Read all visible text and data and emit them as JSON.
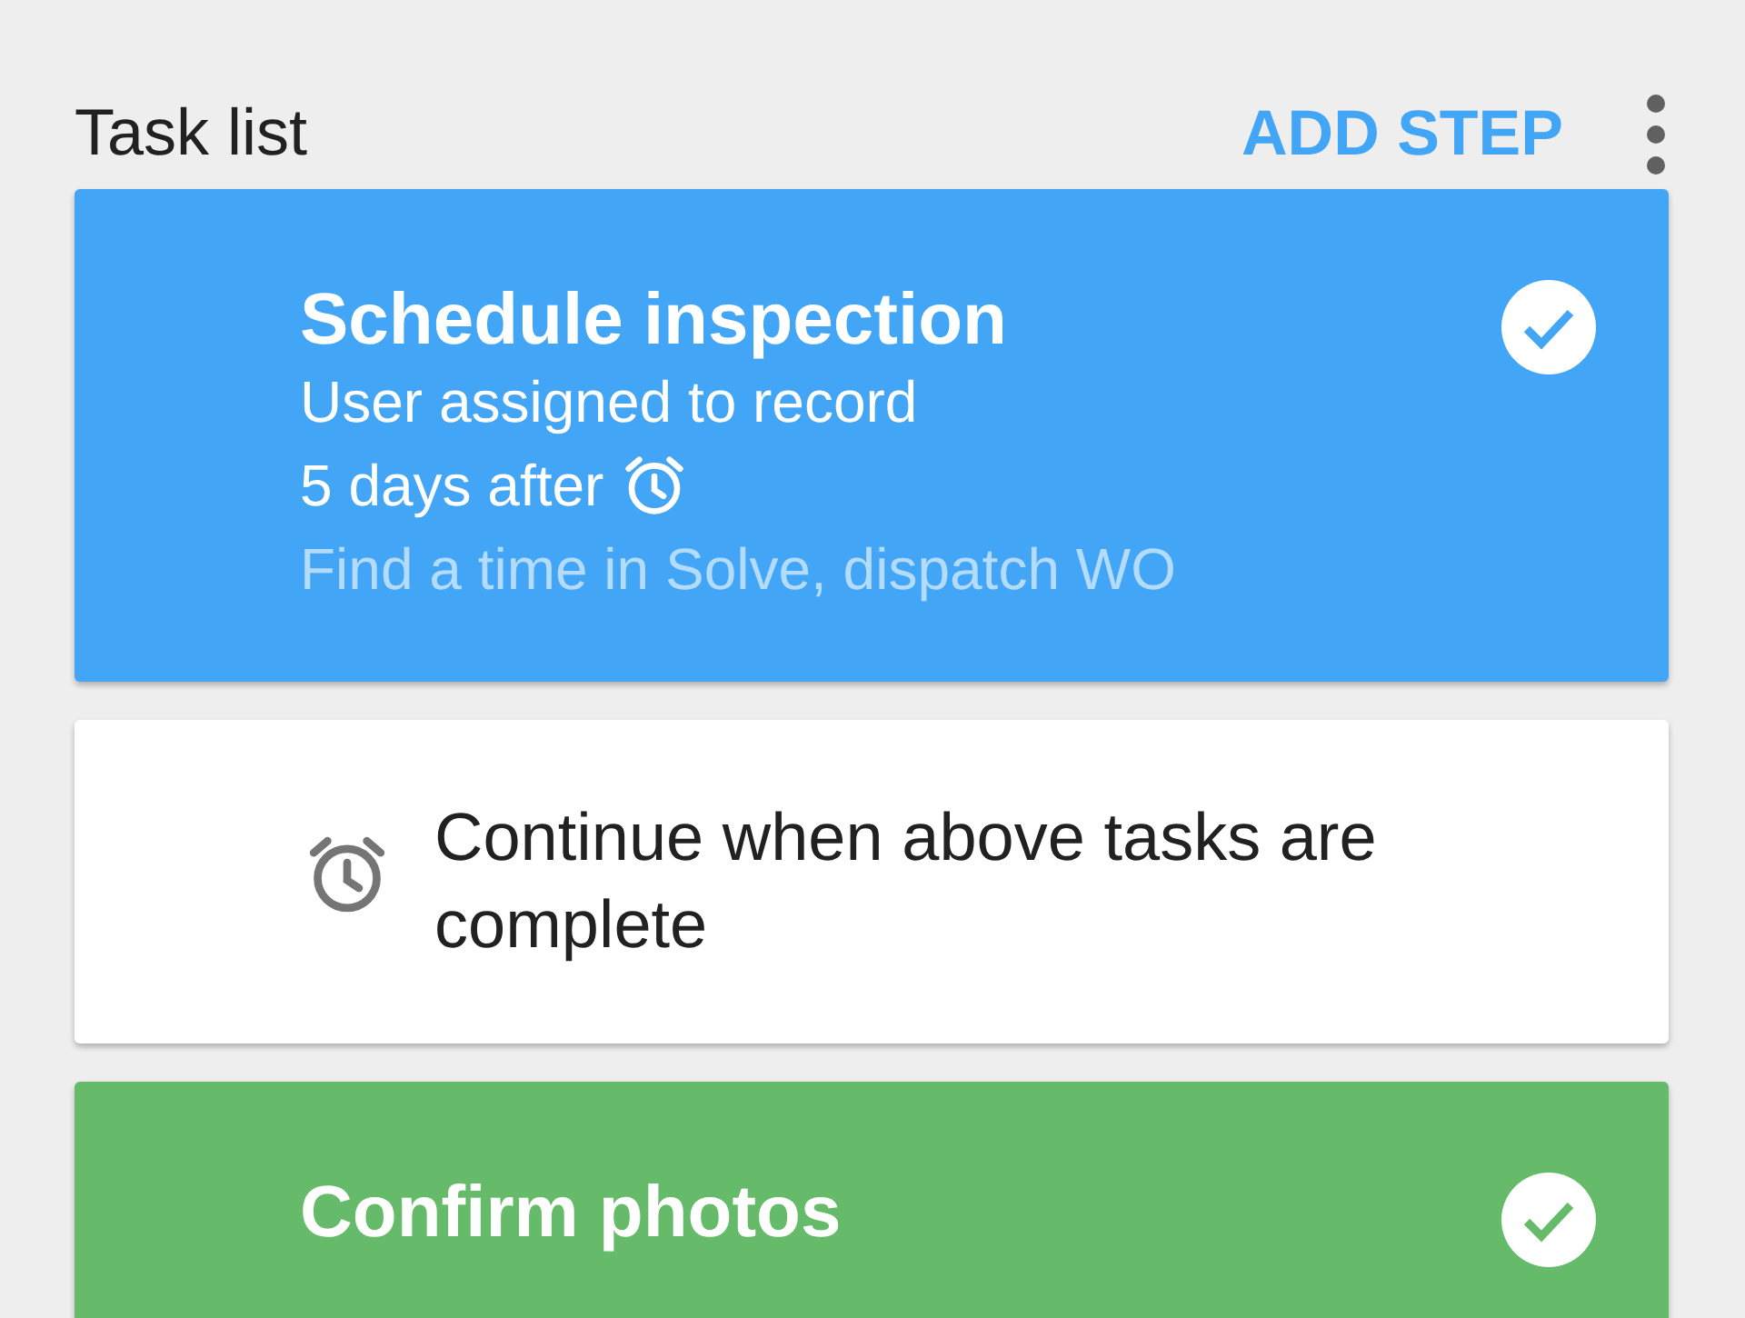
{
  "header": {
    "title": "Task list",
    "action": "ADD STEP"
  },
  "steps": [
    {
      "kind": "task",
      "title": "Schedule inspection",
      "assignee": "User assigned to record",
      "delay": "5 days after",
      "note": "Find a time in Solve, dispatch WO",
      "completed": true,
      "color": "#42a5f5"
    },
    {
      "kind": "wait",
      "text": "Continue when above tasks are complete"
    },
    {
      "kind": "task",
      "title": "Confirm photos",
      "completed": true,
      "color": "#66bb6a"
    }
  ]
}
